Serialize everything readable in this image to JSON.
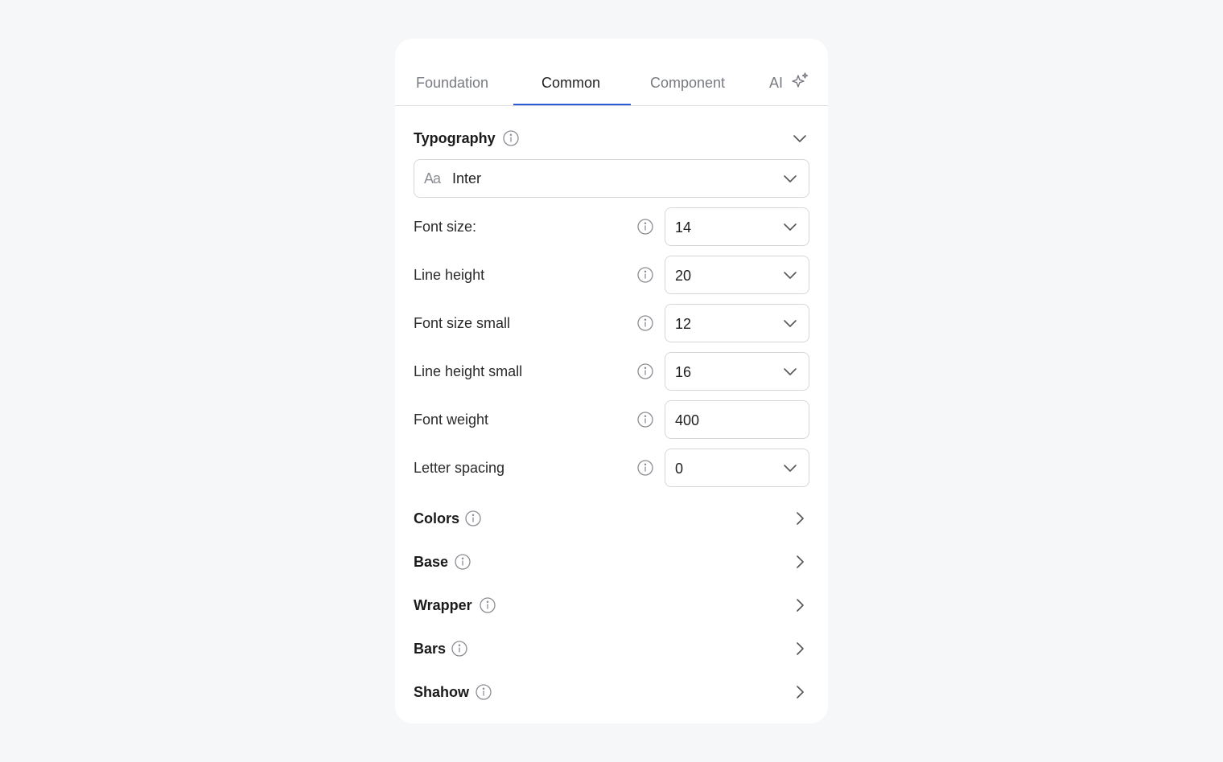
{
  "tabs": [
    {
      "label": "Foundation"
    },
    {
      "label": "Common"
    },
    {
      "label": "Component"
    },
    {
      "label": "AI"
    }
  ],
  "typography": {
    "title": "Typography",
    "font_family": {
      "icon_text": "Aa",
      "value": "Inter"
    },
    "fields": [
      {
        "label": "Font size:",
        "value": "14"
      },
      {
        "label": "Line height",
        "value": "20"
      },
      {
        "label": "Font size small",
        "value": "12"
      },
      {
        "label": "Line height small",
        "value": "16"
      },
      {
        "label": "Font weight",
        "value": "400"
      },
      {
        "label": "Letter spacing",
        "value": "0"
      }
    ]
  },
  "sections": [
    {
      "title": "Colors"
    },
    {
      "title": "Base"
    },
    {
      "title": "Wrapper"
    },
    {
      "title": "Bars"
    },
    {
      "title": "Shahow"
    }
  ],
  "colors": {
    "accent": "#2b5cd6",
    "background": "#f6f7f9",
    "panel": "#ffffff"
  }
}
